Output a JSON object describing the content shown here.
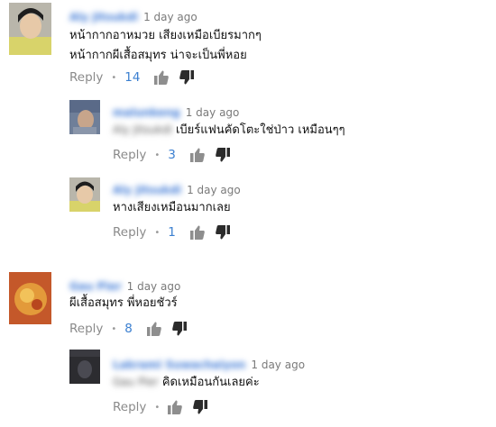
{
  "comments": [
    {
      "author": "Aly Jitsukdi",
      "time": "1 day ago",
      "lines": [
        "หน้ากากอาหมวย เสียงเหมือเบียรมากๆ",
        "หน้ากากผีเสื้อสมุทร น่าจะเป็นพี่หอย"
      ],
      "reply_label": "Reply",
      "likes": "14"
    },
    {
      "author": "malunkeng",
      "mention": "Aly Jitsukdi",
      "time": "1 day ago",
      "lines": [
        "เบียร์แฟนคัดโตะใช่ป่าว เหมือนๆๆ"
      ],
      "reply_label": "Reply",
      "likes": "3"
    },
    {
      "author": "Aly Jitsukdi",
      "time": "1 day ago",
      "lines": [
        "หางเสียงเหมือนมากเลย"
      ],
      "reply_label": "Reply",
      "likes": "1"
    },
    {
      "author": "Gau Pier",
      "time": "1 day ago",
      "lines": [
        "ผีเสื้อสมุทร พี่หอยชัวร์"
      ],
      "reply_label": "Reply",
      "likes": "8"
    },
    {
      "author": "Lakrami Suwachaiyon",
      "mention": "Gau Pier",
      "time": "1 day ago",
      "lines": [
        "คิดเหมือนกันเลยค่ะ"
      ],
      "reply_label": "Reply",
      "likes": ""
    }
  ],
  "icons": {
    "like": "thumbs-up-icon",
    "dislike": "thumbs-down-icon"
  },
  "colors": {
    "link": "#3b7fd0",
    "meta": "#7a7a7a"
  }
}
